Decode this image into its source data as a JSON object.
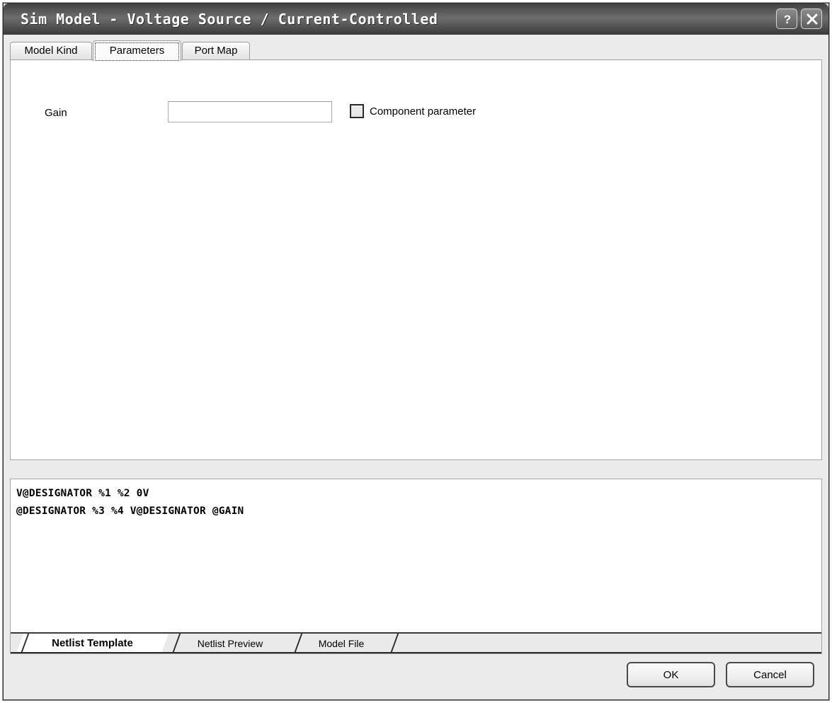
{
  "window": {
    "title": "Sim Model - Voltage Source / Current-Controlled",
    "help_icon": "question-mark-icon",
    "close_icon": "close-x-icon"
  },
  "tabs": [
    {
      "label": "Model Kind",
      "active": false
    },
    {
      "label": "Parameters",
      "active": true
    },
    {
      "label": "Port Map",
      "active": false
    }
  ],
  "parameters": {
    "gain": {
      "label": "Gain",
      "value": "",
      "placeholder": ""
    },
    "component_parameter": {
      "label": "Component parameter",
      "checked": false
    }
  },
  "netlist": {
    "template_text": "V@DESIGNATOR %1 %2 0V\n@DESIGNATOR %3 %4 V@DESIGNATOR @GAIN",
    "tabs": [
      {
        "label": "Netlist Template",
        "active": true
      },
      {
        "label": "Netlist Preview",
        "active": false
      },
      {
        "label": "Model File",
        "active": false
      }
    ]
  },
  "footer": {
    "ok_label": "OK",
    "cancel_label": "Cancel"
  },
  "colors": {
    "titlebar_dark": "#3f3f3f",
    "titlebar_light": "#6d6d6d",
    "dialog_bg": "#ebebeb",
    "panel_bg": "#ffffff",
    "border": "#a6a6a6"
  }
}
